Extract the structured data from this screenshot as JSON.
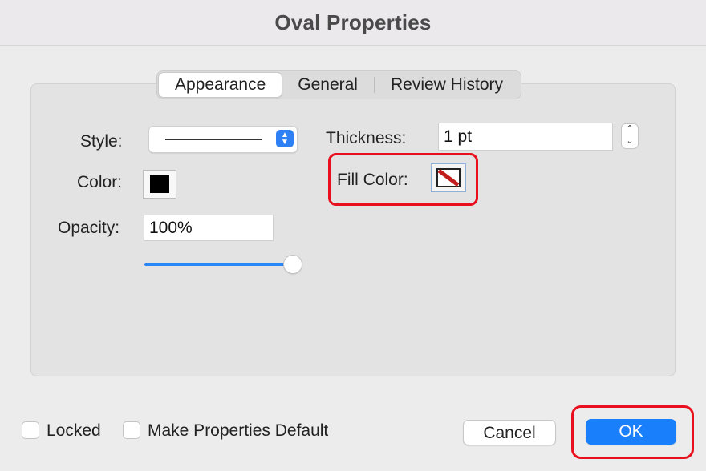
{
  "window": {
    "title": "Oval Properties"
  },
  "tabs": [
    {
      "label": "Appearance",
      "active": true
    },
    {
      "label": "General",
      "active": false
    },
    {
      "label": "Review History",
      "active": false
    }
  ],
  "appearance": {
    "style_label": "Style:",
    "color_label": "Color:",
    "color_value": "#000000",
    "opacity_label": "Opacity:",
    "opacity_value": "100%",
    "opacity_level": 1.0,
    "thickness_label": "Thickness:",
    "thickness_value": "1 pt",
    "fill_color_label": "Fill Color:",
    "fill_color_value": "none"
  },
  "footer": {
    "locked_label": "Locked",
    "locked_checked": false,
    "make_default_label": "Make Properties Default",
    "make_default_checked": false,
    "cancel_label": "Cancel",
    "ok_label": "OK"
  },
  "colors": {
    "accent": "#1a7ffb",
    "highlight": "#e8101e"
  }
}
